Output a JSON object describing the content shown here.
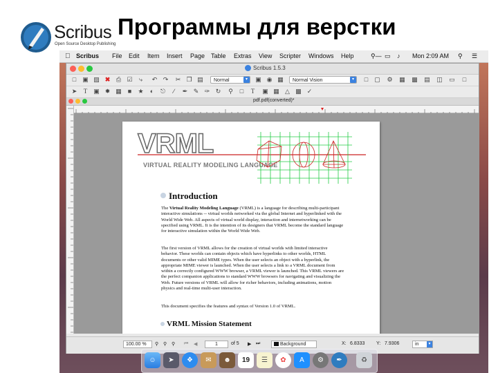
{
  "slide": {
    "title": "Программы для верстки",
    "logo_word": "Scribus",
    "logo_tagline": "Open Source Desktop Publishing"
  },
  "menubar": {
    "app": "Scribus",
    "items": [
      "File",
      "Edit",
      "Item",
      "Insert",
      "Page",
      "Table",
      "Extras",
      "View",
      "Scripter",
      "Windows",
      "Help"
    ],
    "clock": "Mon 2:09 AM"
  },
  "window": {
    "title": "Scribus 1.5.3",
    "style_select": "Normal",
    "view_select": "Normal Vision",
    "doc_title": "pdf.pdf(converted)*"
  },
  "document": {
    "logo_text": "VRML",
    "logo_subtitle": "VIRTUAL REALITY MODELING LANGUAGE",
    "heading1": "Introduction",
    "p1_pre": "The ",
    "p1_bold": "Virtual Reality Modeling Language",
    "p1_post": " (VRML) is a language for describing multi-participant interactive simulations -- virtual worlds networked via the global Internet and hyperlinked with the World Wide Web. All aspects of virtual world display, interaction and internetworking can be specified using VRML. It is the intention of its designers that VRML become the standard language for interactive simulation within the World Wide Web.",
    "p2": "The first version of VRML allows for the creation of virtual worlds with limited interactive behavior. These worlds can contain objects which have hyperlinks to other worlds, HTML documents or other valid MIME types. When the user selects an object with a hyperlink, the appropriate MIME viewer is launched. When the user selects a link to a VRML document from within a correctly configured WWW browser, a VRML viewer is launched. This VRML viewers are the perfect companion applications to standard WWW browsers for navigating and visualizing the Web. Future versions of VRML will allow for richer behaviors, including animations, motion physics and real-time multi-user interaction.",
    "p3": "This document specifies the features and syntax of Version 1.0 of VRML.",
    "heading2": "VRML Mission Statement"
  },
  "statusbar": {
    "zoom": "100.00 %",
    "page_current": "1",
    "page_total": "of 5",
    "layer": "Background",
    "x_label": "X:",
    "x_value": "6.8333",
    "y_label": "Y:",
    "y_value": "7.9306",
    "unit": "in"
  },
  "dock": {
    "calendar_day": "19"
  },
  "colors": {
    "accent_blue": "#3b82e0",
    "grid_green": "#22cc44",
    "red_line": "#cc2222"
  }
}
